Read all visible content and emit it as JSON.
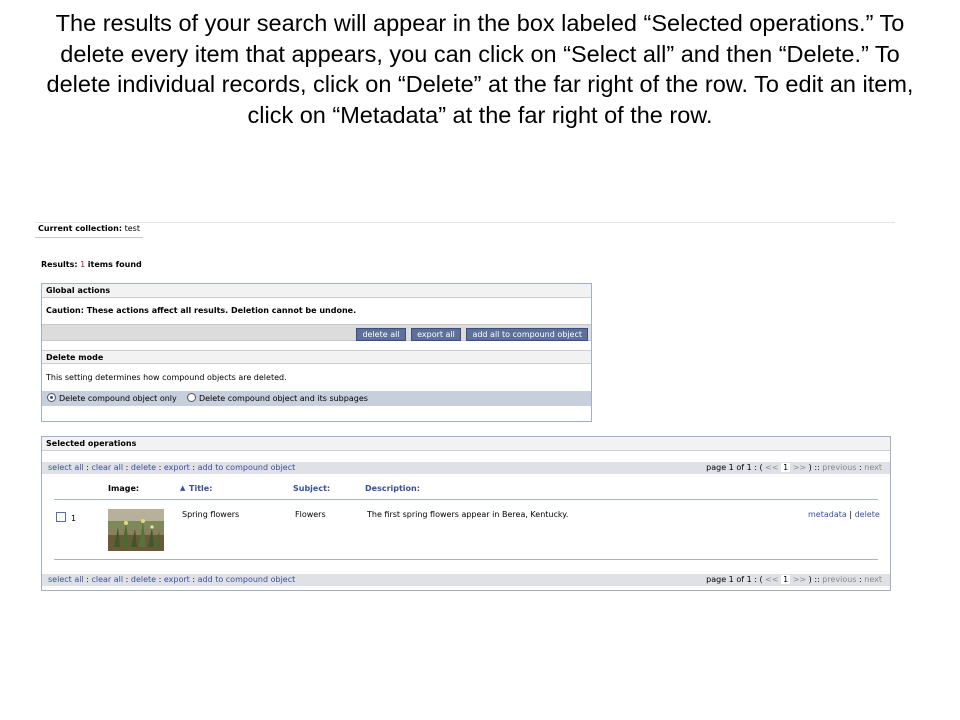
{
  "caption": "The results of your search will appear in the box labeled “Selected operations.” To delete every item that appears, you can click on “Select all” and then “Delete.” To delete individual records, click on “Delete” at the far right of the row. To edit an item, click on “Metadata” at the far right of the row.",
  "collection": {
    "label": "Current collection:",
    "value": "test"
  },
  "results": {
    "label": "Results:",
    "count": "1",
    "suffix": "items found"
  },
  "global_actions": {
    "title": "Global actions",
    "caution": "Caution: These actions affect all results. Deletion cannot be undone.",
    "buttons": {
      "delete_all": "delete all",
      "export_all": "export all",
      "add_all": "add all to compound object"
    }
  },
  "delete_mode": {
    "title": "Delete mode",
    "description": "This setting determines how compound objects are deleted.",
    "option_only": "Delete compound object only",
    "option_subpages": "Delete compound object and its subpages",
    "selected": "option_only"
  },
  "selected_operations": {
    "title": "Selected operations",
    "toolbar": {
      "select_all": "select all",
      "sep": ":",
      "clear_all": "clear all",
      "delete": "delete",
      "export": "export",
      "add_to_compound": "add to compound object"
    },
    "pager": {
      "page_label": "page 1 of 1 : (",
      "prev_arrows": "<<",
      "current": "1",
      "next_arrows": ">>",
      "close": ") ::",
      "previous": "previous",
      "sep": ":",
      "next": "next"
    },
    "columns": {
      "image": "Image:",
      "sort_arrow": "▲",
      "title": "Title:",
      "subject": "Subject:",
      "description": "Description:"
    },
    "rows": [
      {
        "number": "1",
        "title": "Spring flowers",
        "subject": "Flowers",
        "description": "The first spring flowers appear in Berea, Kentucky.",
        "metadata": "metadata",
        "pipe": "|",
        "delete": "delete",
        "checked": false
      }
    ]
  },
  "colors": {
    "accent": "#3a4f9a",
    "button": "#5d6f9b",
    "count": "#c8102e",
    "panel_border": "#9fb0c8",
    "radio_bar": "#c8cfdc"
  }
}
